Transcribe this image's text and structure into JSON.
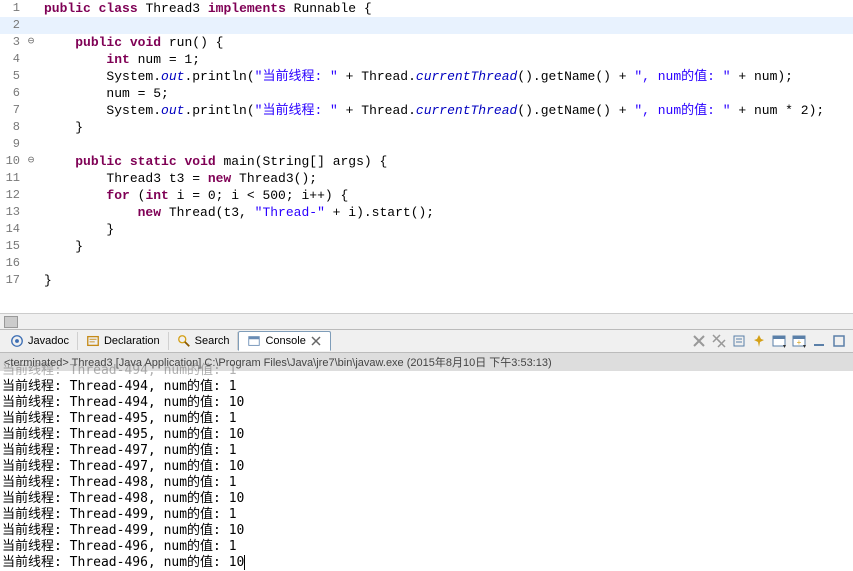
{
  "editor": {
    "lines": [
      {
        "n": 1,
        "g": "",
        "hl": false,
        "tokens": [
          [
            "kw",
            "public"
          ],
          [
            "",
            " "
          ],
          [
            "kw",
            "class"
          ],
          [
            "",
            " Thread3 "
          ],
          [
            "kw",
            "implements"
          ],
          [
            "",
            " Runnable {"
          ]
        ]
      },
      {
        "n": 2,
        "g": "",
        "hl": true,
        "tokens": []
      },
      {
        "n": 3,
        "g": "fold",
        "hl": false,
        "tokens": [
          [
            "",
            "    "
          ],
          [
            "kw",
            "public"
          ],
          [
            "",
            " "
          ],
          [
            "kw",
            "void"
          ],
          [
            "",
            " run() {"
          ]
        ]
      },
      {
        "n": 4,
        "g": "",
        "hl": false,
        "tokens": [
          [
            "",
            "        "
          ],
          [
            "kw",
            "int"
          ],
          [
            "",
            " num = 1;"
          ]
        ]
      },
      {
        "n": 5,
        "g": "",
        "hl": false,
        "tokens": [
          [
            "",
            "        System."
          ],
          [
            "fld",
            "out"
          ],
          [
            "",
            ".println("
          ],
          [
            "str",
            "\"当前线程: \""
          ],
          [
            "",
            " + Thread."
          ],
          [
            "fld",
            "currentThread"
          ],
          [
            "",
            "().getName() + "
          ],
          [
            "str",
            "\", num的值: \""
          ],
          [
            "",
            " + num);"
          ]
        ]
      },
      {
        "n": 6,
        "g": "",
        "hl": false,
        "tokens": [
          [
            "",
            "        num = 5;"
          ]
        ]
      },
      {
        "n": 7,
        "g": "",
        "hl": false,
        "tokens": [
          [
            "",
            "        System."
          ],
          [
            "fld",
            "out"
          ],
          [
            "",
            ".println("
          ],
          [
            "str",
            "\"当前线程: \""
          ],
          [
            "",
            " + Thread."
          ],
          [
            "fld",
            "currentThread"
          ],
          [
            "",
            "().getName() + "
          ],
          [
            "str",
            "\", num的值: \""
          ],
          [
            "",
            " + num * 2);"
          ]
        ]
      },
      {
        "n": 8,
        "g": "",
        "hl": false,
        "tokens": [
          [
            "",
            "    }"
          ]
        ]
      },
      {
        "n": 9,
        "g": "",
        "hl": false,
        "tokens": []
      },
      {
        "n": 10,
        "g": "fold",
        "hl": false,
        "tokens": [
          [
            "",
            "    "
          ],
          [
            "kw",
            "public"
          ],
          [
            "",
            " "
          ],
          [
            "kw",
            "static"
          ],
          [
            "",
            " "
          ],
          [
            "kw",
            "void"
          ],
          [
            "",
            " main(String[] args) {"
          ]
        ]
      },
      {
        "n": 11,
        "g": "",
        "hl": false,
        "tokens": [
          [
            "",
            "        Thread3 t3 = "
          ],
          [
            "kw",
            "new"
          ],
          [
            "",
            " Thread3();"
          ]
        ]
      },
      {
        "n": 12,
        "g": "",
        "hl": false,
        "tokens": [
          [
            "",
            "        "
          ],
          [
            "kw",
            "for"
          ],
          [
            "",
            " ("
          ],
          [
            "kw",
            "int"
          ],
          [
            "",
            " i = 0; i < 500; i++) {"
          ]
        ]
      },
      {
        "n": 13,
        "g": "",
        "hl": false,
        "tokens": [
          [
            "",
            "            "
          ],
          [
            "kw",
            "new"
          ],
          [
            "",
            " Thread(t3, "
          ],
          [
            "str",
            "\"Thread-\""
          ],
          [
            "",
            " + i).start();"
          ]
        ]
      },
      {
        "n": 14,
        "g": "",
        "hl": false,
        "tokens": [
          [
            "",
            "        }"
          ]
        ]
      },
      {
        "n": 15,
        "g": "",
        "hl": false,
        "tokens": [
          [
            "",
            "    }"
          ]
        ]
      },
      {
        "n": 16,
        "g": "",
        "hl": false,
        "tokens": []
      },
      {
        "n": 17,
        "g": "",
        "hl": false,
        "tokens": [
          [
            "",
            "}"
          ]
        ]
      }
    ]
  },
  "tabs": {
    "javadoc": "Javadoc",
    "declaration": "Declaration",
    "search": "Search",
    "console": "Console"
  },
  "console": {
    "header": "<terminated> Thread3 [Java Application] C:\\Program Files\\Java\\jre7\\bin\\javaw.exe (2015年8月10日 下午3:53:13)",
    "lines": [
      "当前线程: Thread-494, num的值: 1",
      "当前线程: Thread-494, num的值: 10",
      "当前线程: Thread-495, num的值: 1",
      "当前线程: Thread-495, num的值: 10",
      "当前线程: Thread-497, num的值: 1",
      "当前线程: Thread-497, num的值: 10",
      "当前线程: Thread-498, num的值: 1",
      "当前线程: Thread-498, num的值: 10",
      "当前线程: Thread-499, num的值: 1",
      "当前线程: Thread-499, num的值: 10",
      "当前线程: Thread-496, num的值: 1",
      "当前线程: Thread-496, num的值: 10"
    ]
  }
}
